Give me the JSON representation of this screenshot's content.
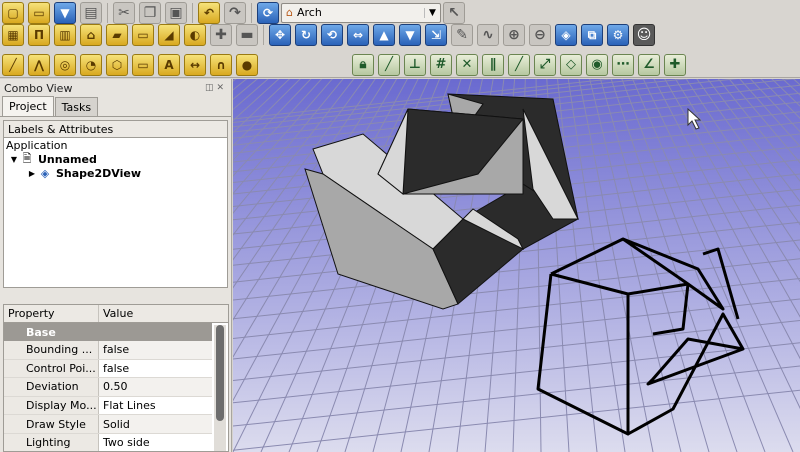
{
  "toolbar": {
    "workbench_selector": {
      "icon": "arch-workbench-icon",
      "value": "Arch"
    }
  },
  "combo": {
    "title": "Combo View",
    "tabs": [
      {
        "label": "Project"
      },
      {
        "label": "Tasks"
      }
    ],
    "labels_header": "Labels & Attributes",
    "tree": {
      "root": "Application",
      "document": "Unnamed",
      "object": "Shape2DView"
    },
    "property_table": {
      "col_property": "Property",
      "col_value": "Value",
      "group": "Base",
      "rows": [
        {
          "name": "Bounding ...",
          "value": "false"
        },
        {
          "name": "Control Poi...",
          "value": "false"
        },
        {
          "name": "Deviation",
          "value": "0.50"
        },
        {
          "name": "Display Mo...",
          "value": "Flat Lines"
        },
        {
          "name": "Draw Style",
          "value": "Solid"
        },
        {
          "name": "Lighting",
          "value": "Two side"
        }
      ]
    }
  },
  "colors": {
    "viewport_top": "#6a6ad0",
    "viewport_bottom": "#dcdcee",
    "grid": "#8a8ab0",
    "face_light": "#d8d8d8",
    "face_mid": "#a8a8a8",
    "face_dark": "#2b2b2b"
  }
}
